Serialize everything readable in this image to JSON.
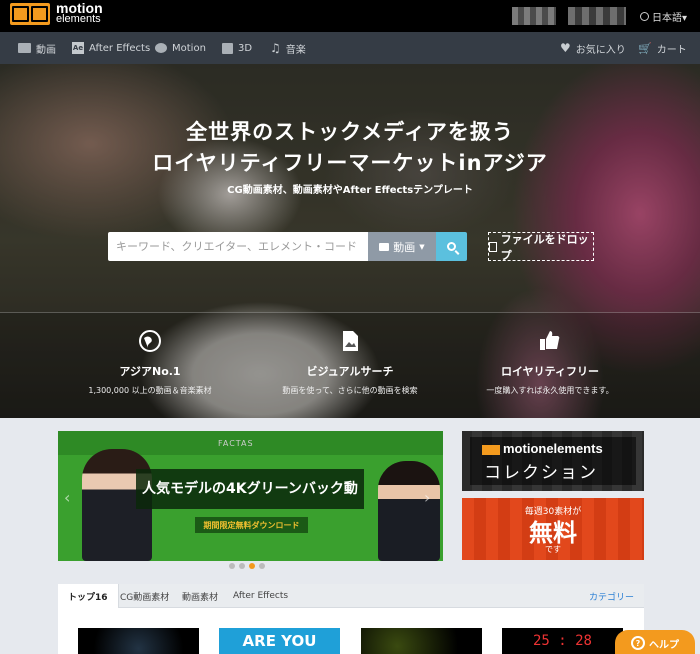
{
  "header": {
    "logo_line1": "motion",
    "logo_line2": "elements",
    "language": "日本語▾"
  },
  "nav": {
    "left": [
      {
        "label": "動画",
        "icon": "video-camera-icon"
      },
      {
        "label": "After Effects",
        "icon": "after-effects-icon"
      },
      {
        "label": "Motion",
        "icon": "motion-icon"
      },
      {
        "label": "3D",
        "icon": "cube-icon"
      },
      {
        "label": "音楽",
        "icon": "music-note-icon"
      }
    ],
    "favorites": "お気に入り",
    "cart": "カート"
  },
  "hero": {
    "title_line1": "全世界のストックメディアを扱う",
    "title_line2": "ロイヤリティフリーマーケットinアジア",
    "subtitle": "CG動画素材、動画素材やAfter Effectsテンプレート",
    "search_placeholder": "キーワード、クリエイター、エレメント・コード",
    "search_type": "動画",
    "drop_label": "ファイルをドロップ"
  },
  "features": [
    {
      "title": "アジアNo.1",
      "desc": "1,300,000 以上の動画＆音楽素材",
      "icon": "globe-icon"
    },
    {
      "title": "ビジュアルサーチ",
      "desc": "動画を使って、さらに他の動画を検索",
      "icon": "image-file-icon"
    },
    {
      "title": "ロイヤリティフリー",
      "desc": "一度購入すれば永久使用できます。",
      "icon": "thumbs-up-icon"
    }
  ],
  "banner": {
    "logo": "FACTAS",
    "headline": "人気モデルの4Kグリーンバック動",
    "cta": "期間限定無料ダウンロード"
  },
  "side_banners": {
    "collection_brand": "motionelements",
    "collection_sub": "コレクション",
    "free_line1": "毎週30素材が",
    "free_line2": "無料",
    "free_line3": "です"
  },
  "carousel": {
    "dot_count": 4,
    "active_index": 2
  },
  "tabs": {
    "items": [
      "トップ16",
      "CG動画素材",
      "動画素材",
      "After Effects"
    ],
    "category": "カテゴリー"
  },
  "thumbnails": {
    "thumb2_text": "ARE YOU",
    "thumb4_text": "25 : 28"
  },
  "help": "ヘルプ"
}
